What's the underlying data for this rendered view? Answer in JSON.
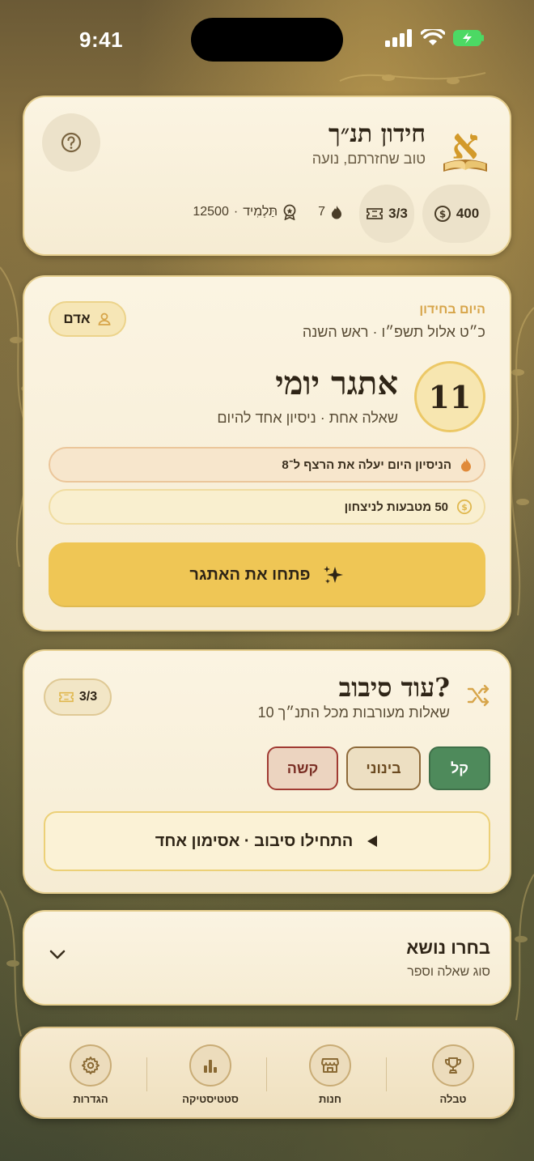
{
  "status_bar": {
    "time": "9:41"
  },
  "header": {
    "app_title": "חידון תנ״ך",
    "greeting": "טוב שחזרתם, נועה",
    "coins": "400",
    "tickets": "3/3",
    "streak": "7",
    "rank_label": "תַּלְמִיד",
    "xp": "12500",
    "separator": "·",
    "logo_icon": "aleph-book-logo",
    "help_icon": "question-icon"
  },
  "daily": {
    "today_label": "היום בחידון",
    "date_line": "כ״ט אלול תשפ״ו · ראש השנה",
    "user_name": "אדם",
    "day_number": "11",
    "title": "אתגר יומי",
    "subtitle": "שאלה אחת · ניסיון אחד להיום",
    "streak_note": "הניסיון היום יעלה את הרצף ל־8",
    "reward_note": "50 מטבעות לניצחון",
    "cta_label": "פתחו את האתגר"
  },
  "round": {
    "title": "עוד סיבוב?",
    "subtitle": "10 שאלות מעורבות מכל התנ״ך",
    "tickets": "3/3",
    "difficulties": [
      "קל",
      "בינוני",
      "קשה"
    ],
    "selected_difficulty": "קל",
    "start_label": "התחילו סיבוב · אסימון אחד"
  },
  "topic": {
    "title": "בחרו נושא",
    "subtitle": "סוג שאלה וספר"
  },
  "nav": {
    "items": [
      {
        "label": "טבלה",
        "icon": "trophy-icon"
      },
      {
        "label": "חנות",
        "icon": "shop-icon"
      },
      {
        "label": "סטטיסטיקה",
        "icon": "bar-chart-icon"
      },
      {
        "label": "הגדרות",
        "icon": "gear-icon"
      }
    ]
  },
  "colors": {
    "accent": "#efc655",
    "easy": "#4e8a5b",
    "hard": "#a03a32",
    "card": "#fbf4e2"
  }
}
